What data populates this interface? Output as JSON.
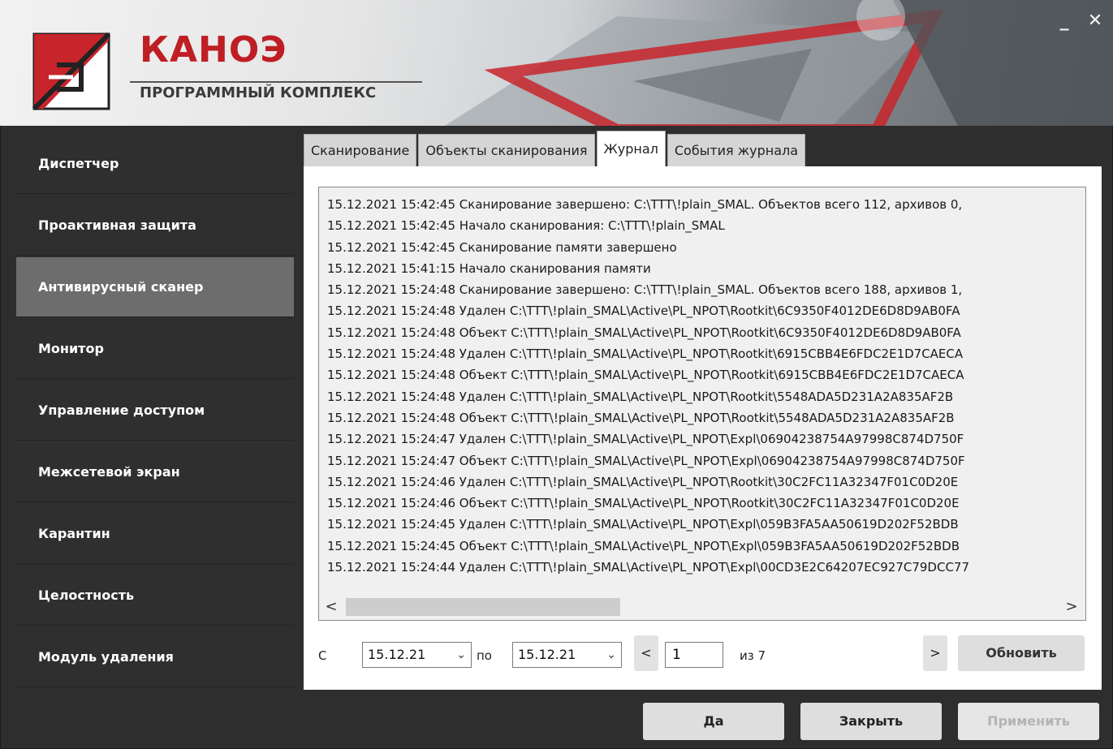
{
  "header": {
    "brand": "КАНОЭ",
    "subtitle": "ПРОГРАММНЫЙ КОМПЛЕКС",
    "controls": {
      "minimize": "_",
      "close": "✕"
    }
  },
  "sidebar": {
    "items": [
      {
        "label": "Диспетчер"
      },
      {
        "label": "Проактивная защита"
      },
      {
        "label": "Антивирусный сканер",
        "active": true
      },
      {
        "label": "Монитор"
      },
      {
        "label": "Управление доступом"
      },
      {
        "label": "Межсетевой экран"
      },
      {
        "label": "Карантин"
      },
      {
        "label": "Целостность"
      },
      {
        "label": "Модуль удаления"
      }
    ]
  },
  "tabs": [
    {
      "label": "Сканирование"
    },
    {
      "label": "Объекты сканирования"
    },
    {
      "label": "Журнал",
      "active": true
    },
    {
      "label": "События журнала"
    }
  ],
  "log": {
    "lines": [
      "15.12.2021 15:42:45 Сканирование завершено: C:\\TTT\\!plain_SMAL. Объектов всего 112, архивов 0,",
      "15.12.2021 15:42:45 Начало сканирования: C:\\TTT\\!plain_SMAL",
      "15.12.2021 15:42:45 Сканирование памяти завершено",
      "15.12.2021 15:41:15 Начало сканирования памяти",
      "15.12.2021 15:24:48 Сканирование завершено: C:\\TTT\\!plain_SMAL. Объектов всего 188, архивов 1,",
      "15.12.2021 15:24:48 Удален C:\\TTT\\!plain_SMAL\\Active\\PL_NPOT\\Rootkit\\6C9350F4012DE6D8D9AB0FA",
      "15.12.2021 15:24:48 Объект C:\\TTT\\!plain_SMAL\\Active\\PL_NPOT\\Rootkit\\6C9350F4012DE6D8D9AB0FA",
      "15.12.2021 15:24:48 Удален C:\\TTT\\!plain_SMAL\\Active\\PL_NPOT\\Rootkit\\6915CBB4E6FDC2E1D7CAECA",
      "15.12.2021 15:24:48 Объект C:\\TTT\\!plain_SMAL\\Active\\PL_NPOT\\Rootkit\\6915CBB4E6FDC2E1D7CAECA",
      "15.12.2021 15:24:48 Удален C:\\TTT\\!plain_SMAL\\Active\\PL_NPOT\\Rootkit\\5548ADA5D231A2A835AF2B",
      "15.12.2021 15:24:48 Объект C:\\TTT\\!plain_SMAL\\Active\\PL_NPOT\\Rootkit\\5548ADA5D231A2A835AF2B",
      "15.12.2021 15:24:47 Удален C:\\TTT\\!plain_SMAL\\Active\\PL_NPOT\\Expl\\06904238754A97998C874D750F",
      "15.12.2021 15:24:47 Объект C:\\TTT\\!plain_SMAL\\Active\\PL_NPOT\\Expl\\06904238754A97998C874D750F",
      "15.12.2021 15:24:46 Удален C:\\TTT\\!plain_SMAL\\Active\\PL_NPOT\\Rootkit\\30C2FC11A32347F01C0D20E",
      "15.12.2021 15:24:46 Объект C:\\TTT\\!plain_SMAL\\Active\\PL_NPOT\\Rootkit\\30C2FC11A32347F01C0D20E",
      "15.12.2021 15:24:45 Удален C:\\TTT\\!plain_SMAL\\Active\\PL_NPOT\\Expl\\059B3FA5AA50619D202F52BDB",
      "15.12.2021 15:24:45 Объект C:\\TTT\\!plain_SMAL\\Active\\PL_NPOT\\Expl\\059B3FA5AA50619D202F52BDB",
      "15.12.2021 15:24:44 Удален C:\\TTT\\!plain_SMAL\\Active\\PL_NPOT\\Expl\\00CD3E2C64207EC927C79DCC77"
    ],
    "scroll_left": "<",
    "scroll_right": ">"
  },
  "filter": {
    "from_label": "С",
    "from_value": "15.12.21",
    "to_label": "по",
    "to_value": "15.12.21",
    "prev": "<",
    "page": "1",
    "of_label": "из 7",
    "next": ">",
    "refresh": "Обновить"
  },
  "footer": {
    "ok": "Да",
    "close": "Закрыть",
    "apply": "Применить"
  },
  "colors": {
    "brand_red": "#bf1e24",
    "sidebar_bg": "#2f2f2f",
    "sidebar_active": "#6d6d6d"
  }
}
